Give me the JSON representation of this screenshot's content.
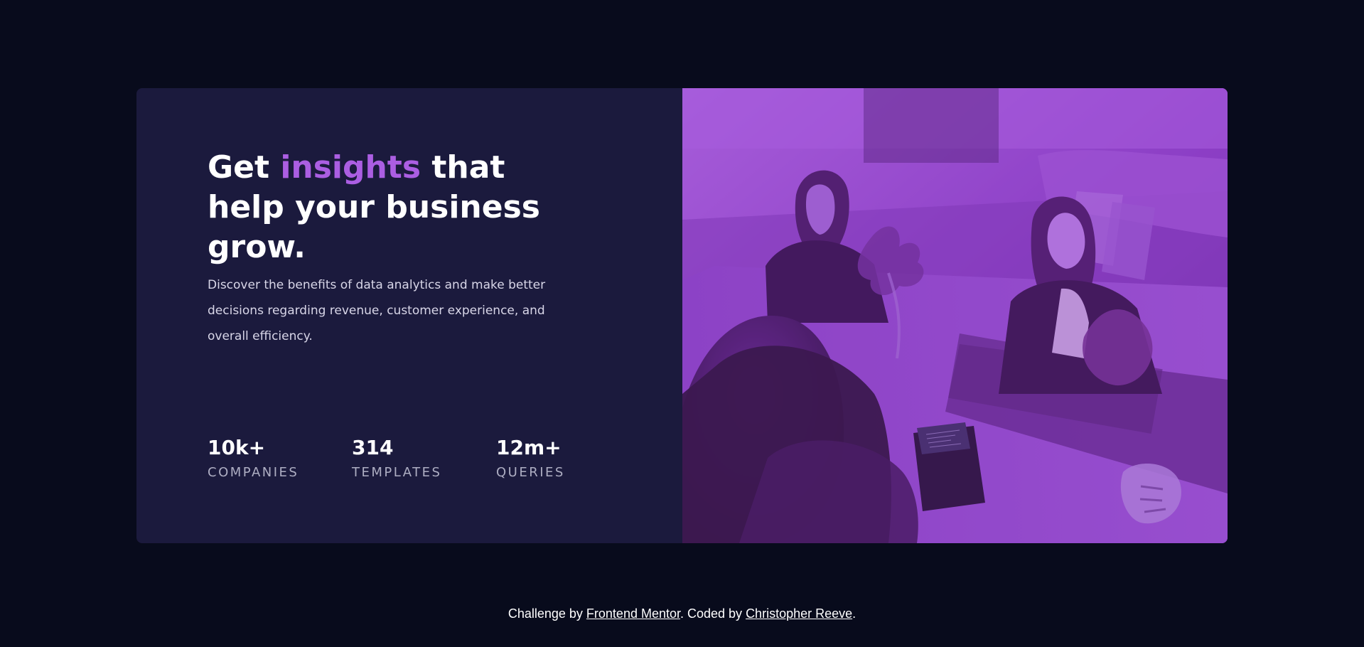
{
  "colors": {
    "page_background": "#080b1c",
    "card_background": "#1b1a3d",
    "accent": "#ab5ee2",
    "image_overlay": "#8b3fc4",
    "heading_text": "#ffffff",
    "body_text": "#d8d6e8",
    "stat_label": "#aeaec3"
  },
  "hero": {
    "headline_start": "Get ",
    "headline_accent": "insights",
    "headline_end": " that help your business grow.",
    "body": "Discover the benefits of data analytics and make better decisions regarding revenue, customer experience, and overall efficiency."
  },
  "stats": [
    {
      "value": "10k+",
      "label": "COMPANIES"
    },
    {
      "value": "314",
      "label": "TEMPLATES"
    },
    {
      "value": "12m+",
      "label": "QUERIES"
    }
  ],
  "image": {
    "content": "office-team-photo"
  },
  "footer": {
    "prefix": "Challenge by ",
    "challenge_link": "Frontend Mentor",
    "middle": ". Coded by ",
    "author_link": "Christopher Reeve",
    "suffix": "."
  }
}
